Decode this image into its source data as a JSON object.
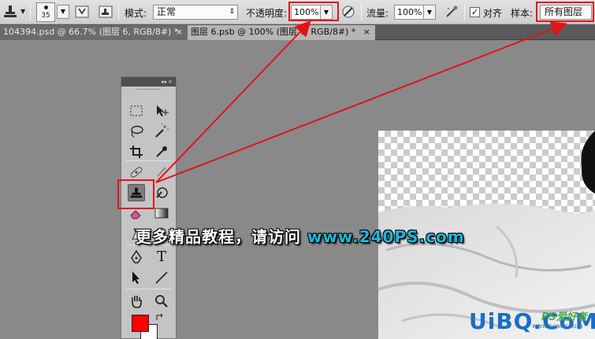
{
  "options_bar": {
    "brush_size": "35",
    "mode_label": "模式:",
    "mode_value": "正常",
    "opacity_label": "不透明度:",
    "opacity_value": "100%",
    "flow_label": "流量:",
    "flow_value": "100%",
    "align_label": "对齐",
    "align_checked": "✓",
    "sample_label": "样本:",
    "sample_value": "所有图层",
    "dropdown_arrow": "▼"
  },
  "tabs": [
    {
      "label": "104394.psd @ 66.7% (图层 6, RGB/8#) *",
      "close": "×"
    },
    {
      "label": "图层 6.psb @ 100% (图层 7, RGB/8#) *",
      "close": "×"
    }
  ],
  "toolbox": {
    "collapse": "◂◂  ×",
    "type_tool": "T",
    "foreground_color": "#ff0000",
    "background_color": "#ffffff"
  },
  "overlay": {
    "promo_text": "更多精品教程，请访问 ",
    "promo_url": "www.240PS.com",
    "logo_main": "UiBQ.CoM",
    "logo_sub": "PS爱好者",
    "logo_small": "www.psahz.com"
  },
  "annotation_color": "#e0141b",
  "accent_url_color": "#1fb6d8"
}
